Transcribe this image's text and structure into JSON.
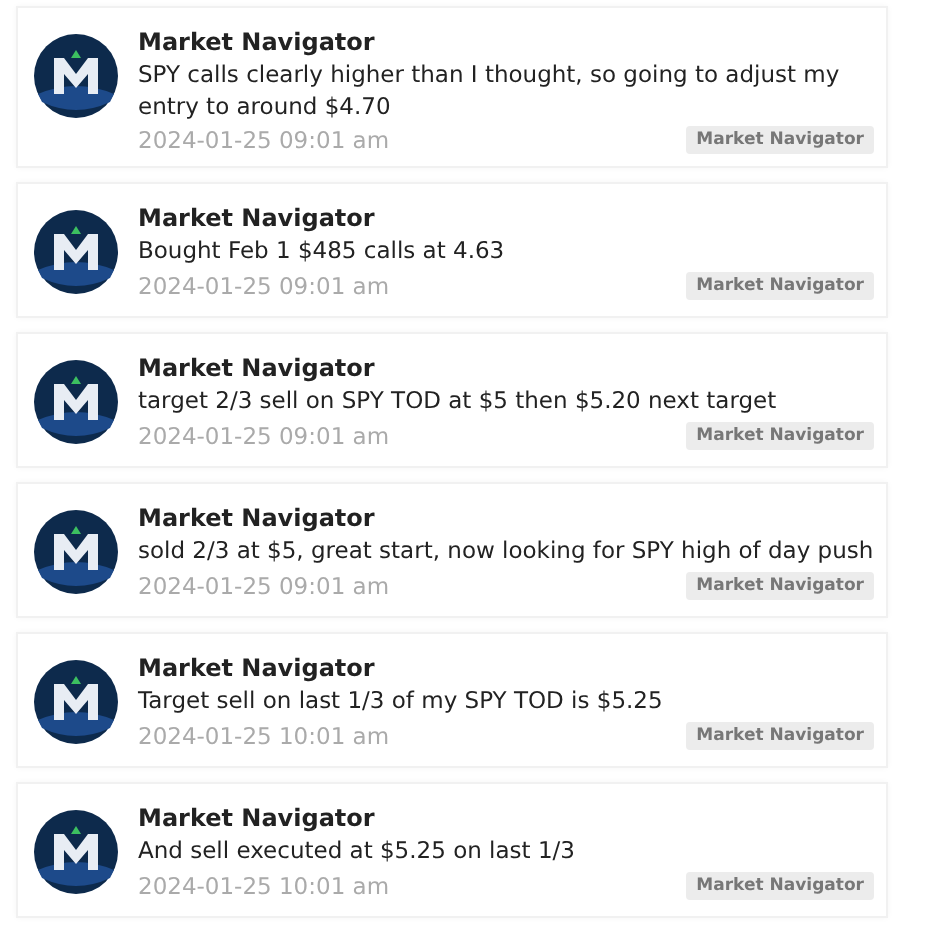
{
  "messages": [
    {
      "author": "Market Navigator",
      "text": "SPY calls clearly higher than I thought, so going to adjust my entry to around $4.70",
      "time": "2024-01-25 09:01 am",
      "tag": "Market Navigator"
    },
    {
      "author": "Market Navigator",
      "text": "Bought Feb 1 $485 calls at 4.63",
      "time": "2024-01-25 09:01 am",
      "tag": "Market Navigator"
    },
    {
      "author": "Market Navigator",
      "text": "target 2/3 sell on SPY TOD at $5 then $5.20 next target",
      "time": "2024-01-25 09:01 am",
      "tag": "Market Navigator"
    },
    {
      "author": "Market Navigator",
      "text": "sold 2/3 at $5, great start, now looking for SPY high of day push",
      "time": "2024-01-25 09:01 am",
      "tag": "Market Navigator"
    },
    {
      "author": "Market Navigator",
      "text": "Target sell on last 1/3 of my SPY TOD is $5.25",
      "time": "2024-01-25 10:01 am",
      "tag": "Market Navigator"
    },
    {
      "author": "Market Navigator",
      "text": "And sell executed at $5.25 on last 1/3",
      "time": "2024-01-25 10:01 am",
      "tag": "Market Navigator"
    }
  ]
}
